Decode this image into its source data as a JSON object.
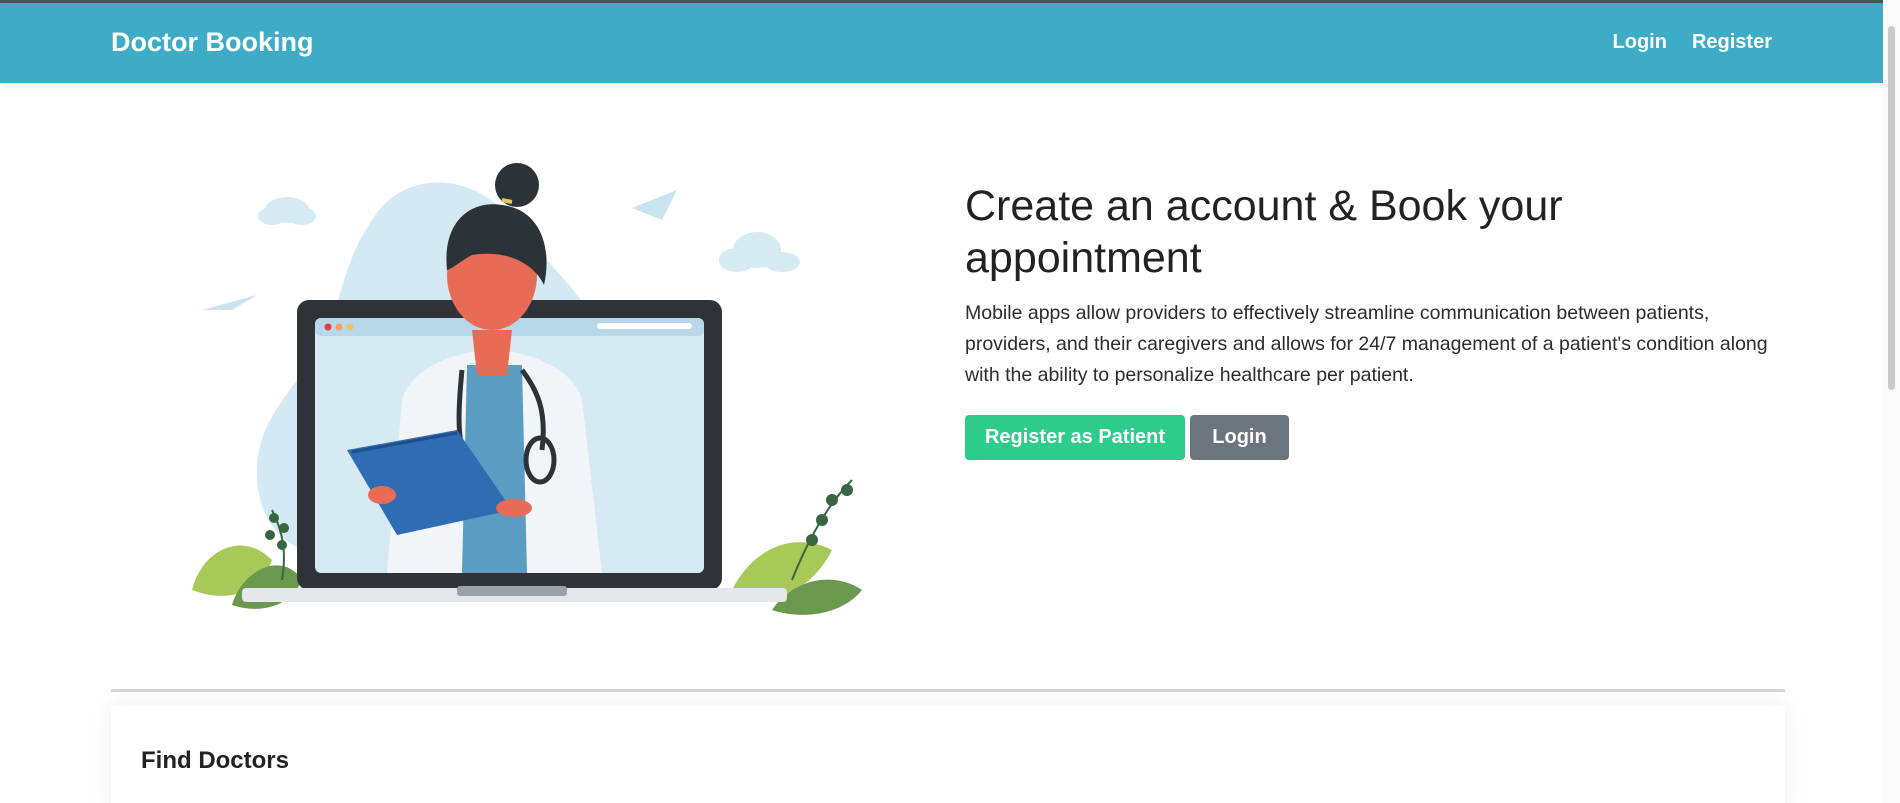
{
  "nav": {
    "brand": "Doctor Booking",
    "login": "Login",
    "register": "Register"
  },
  "hero": {
    "title": "Create an account & Book your appointment",
    "description": "Mobile apps allow providers to effectively streamline communication between patients, providers, and their caregivers and allows for 24/7 management of a patient's condition along with the ability to personalize healthcare per patient.",
    "register_button": "Register as Patient",
    "login_button": "Login",
    "illustration": "doctor-laptop-illustration"
  },
  "find_doctors": {
    "title": "Find Doctors"
  },
  "colors": {
    "navbar": "#3eacc6",
    "register_button": "#2ecc8a",
    "login_button": "#6c757d"
  }
}
